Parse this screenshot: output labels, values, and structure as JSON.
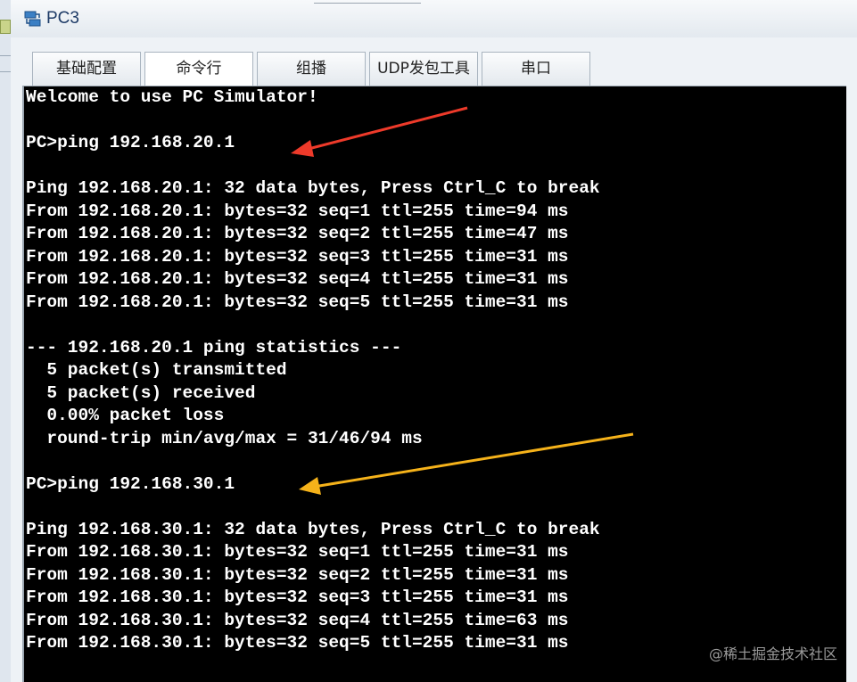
{
  "window": {
    "title": "PC3",
    "icon": "network-pc-icon"
  },
  "tabs": [
    {
      "label": "基础配置",
      "active": false
    },
    {
      "label": "命令行",
      "active": true
    },
    {
      "label": "组播",
      "active": false
    },
    {
      "label": "UDP发包工具",
      "active": false
    },
    {
      "label": "串口",
      "active": false
    }
  ],
  "terminal": {
    "lines": [
      "Welcome to use PC Simulator!",
      "",
      "PC>ping 192.168.20.1",
      "",
      "Ping 192.168.20.1: 32 data bytes, Press Ctrl_C to break",
      "From 192.168.20.1: bytes=32 seq=1 ttl=255 time=94 ms",
      "From 192.168.20.1: bytes=32 seq=2 ttl=255 time=47 ms",
      "From 192.168.20.1: bytes=32 seq=3 ttl=255 time=31 ms",
      "From 192.168.20.1: bytes=32 seq=4 ttl=255 time=31 ms",
      "From 192.168.20.1: bytes=32 seq=5 ttl=255 time=31 ms",
      "",
      "--- 192.168.20.1 ping statistics ---",
      "  5 packet(s) transmitted",
      "  5 packet(s) received",
      "  0.00% packet loss",
      "  round-trip min/avg/max = 31/46/94 ms",
      "",
      "PC>ping 192.168.30.1",
      "",
      "Ping 192.168.30.1: 32 data bytes, Press Ctrl_C to break",
      "From 192.168.30.1: bytes=32 seq=1 ttl=255 time=31 ms",
      "From 192.168.30.1: bytes=32 seq=2 ttl=255 time=31 ms",
      "From 192.168.30.1: bytes=32 seq=3 ttl=255 time=31 ms",
      "From 192.168.30.1: bytes=32 seq=4 ttl=255 time=63 ms",
      "From 192.168.30.1: bytes=32 seq=5 ttl=255 time=31 ms"
    ]
  },
  "annotations": {
    "arrow1_color": "#ee3a2a",
    "arrow2_color": "#f5b21a"
  },
  "watermark": "@稀土掘金技术社区"
}
